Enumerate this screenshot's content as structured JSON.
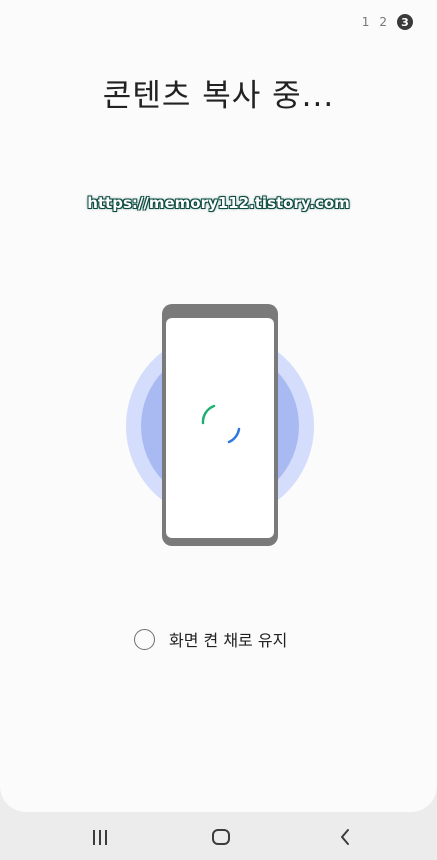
{
  "stepper": {
    "steps": [
      "1",
      "2",
      "3"
    ],
    "current_step": "3"
  },
  "title": "콘텐츠 복사 중...",
  "watermark": "https://memory112.tistory.com",
  "keep_screen_on": {
    "label": "화면 켠 채로 유지",
    "checked": false
  },
  "navigation": {
    "recent_icon": "recent-apps-icon",
    "home_icon": "home-icon",
    "back_icon": "back-icon"
  },
  "colors": {
    "progress_green": "#1db072",
    "progress_blue": "#2f78e0",
    "halo_outer": "#d4ddfb",
    "halo_inner": "#a9baf3",
    "device_frame": "#7a7a7a"
  }
}
